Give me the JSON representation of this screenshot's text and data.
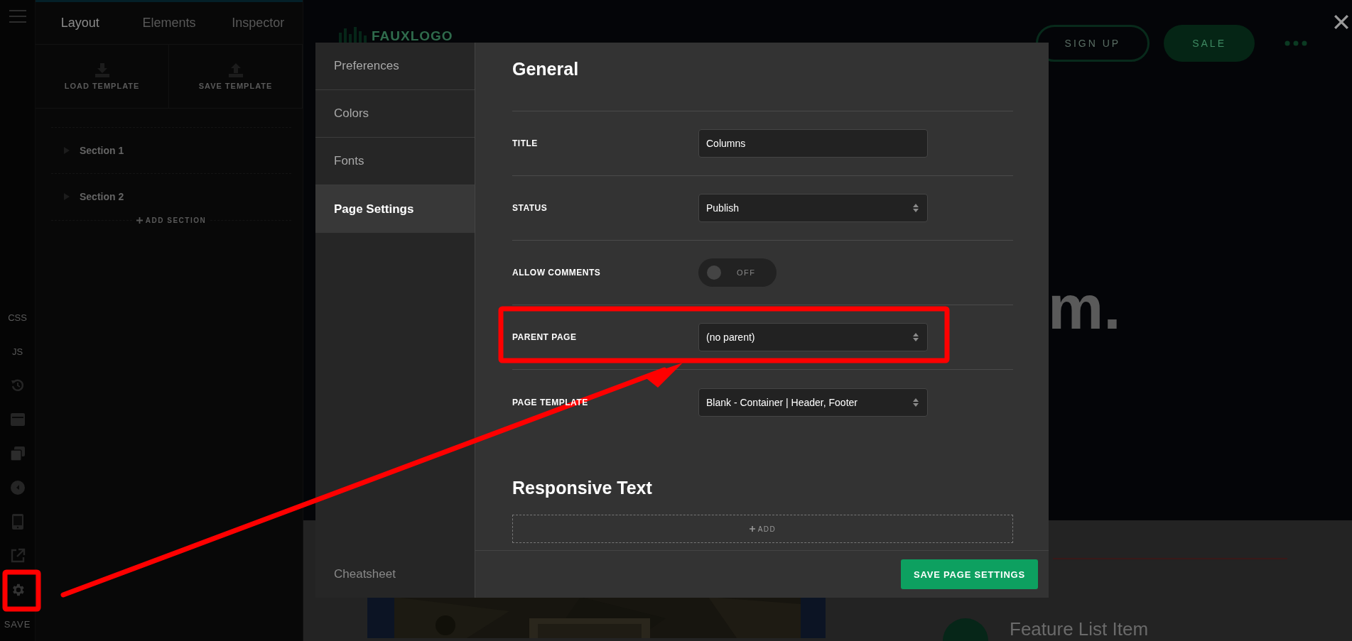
{
  "rail": {
    "code_buttons": [
      "CSS",
      "JS"
    ],
    "save_label": "SAVE"
  },
  "panel": {
    "tabs": [
      {
        "label": "Layout",
        "selected": true
      },
      {
        "label": "Elements",
        "selected": false
      },
      {
        "label": "Inspector",
        "selected": false
      }
    ],
    "template_buttons": [
      {
        "label": "LOAD TEMPLATE",
        "kind": "load"
      },
      {
        "label": "SAVE TEMPLATE",
        "kind": "save"
      }
    ],
    "sections": [
      {
        "label": "Section 1",
        "expanded": false
      },
      {
        "label": "Section 2",
        "expanded": false
      }
    ],
    "add_section": "ADD SECTION"
  },
  "site": {
    "logo": "FAUXLOGO",
    "buttons": [
      {
        "label": "SIGN UP",
        "kind": "outline"
      },
      {
        "label": "SALE",
        "kind": "filled"
      }
    ],
    "hero_fragment": "m.",
    "feature_title": "Feature List Item"
  },
  "modal": {
    "nav": [
      {
        "label": "Preferences",
        "selected": false
      },
      {
        "label": "Colors",
        "selected": false
      },
      {
        "label": "Fonts",
        "selected": false
      },
      {
        "label": "Page Settings",
        "selected": true
      }
    ],
    "nav_footer": "Cheatsheet",
    "heading": "General",
    "fields": [
      {
        "label": "TITLE",
        "kind": "text",
        "value": "Columns"
      },
      {
        "label": "STATUS",
        "kind": "select",
        "value": "Publish"
      },
      {
        "label": "ALLOW COMMENTS",
        "kind": "toggle",
        "on": false,
        "value": "OFF"
      },
      {
        "label": "PARENT PAGE",
        "kind": "select",
        "value": "(no parent)"
      },
      {
        "label": "PAGE TEMPLATE",
        "kind": "select",
        "value": "Blank - Container | Header, Footer"
      }
    ],
    "responsive_heading": "Responsive Text",
    "add_label": "ADD",
    "save_button": "SAVE PAGE SETTINGS"
  }
}
